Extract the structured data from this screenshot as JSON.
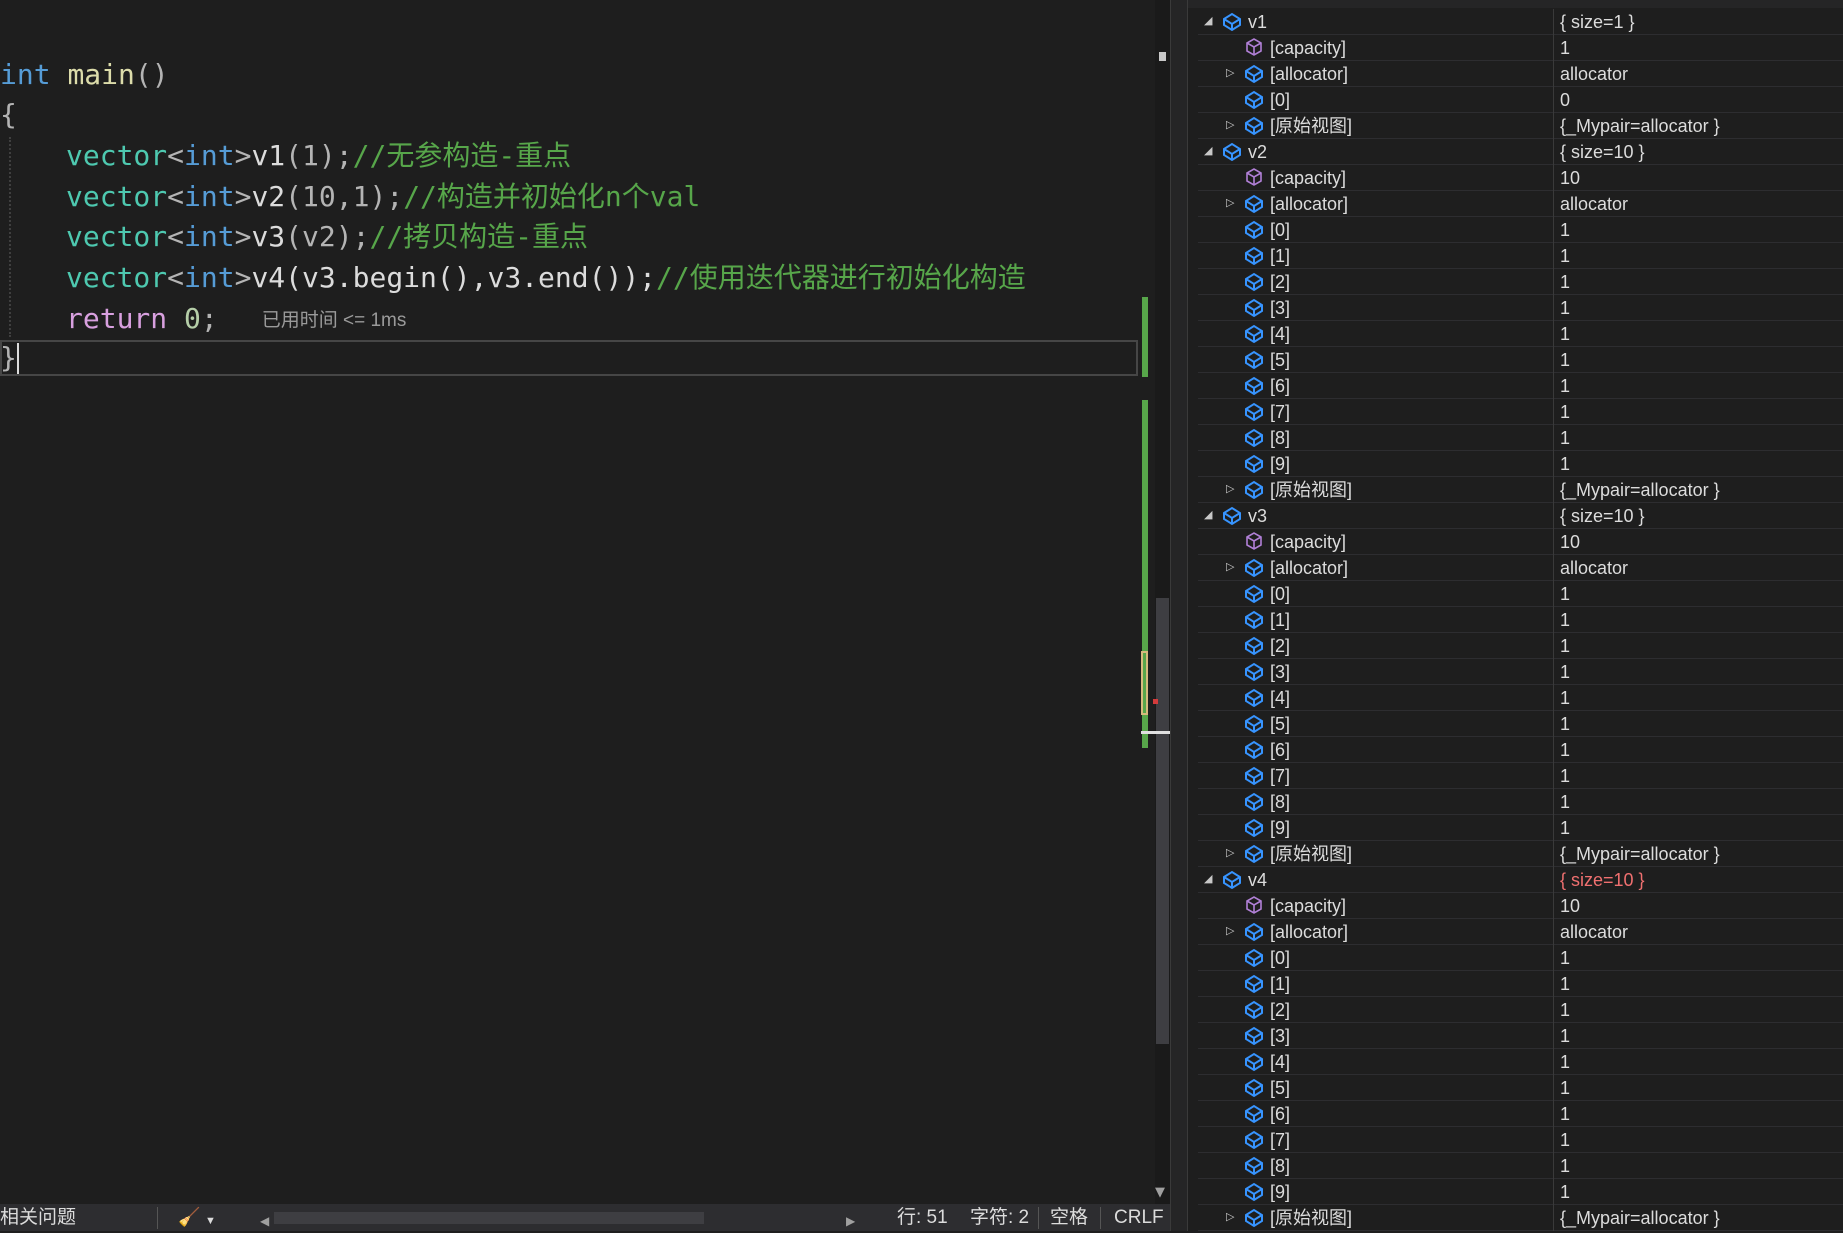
{
  "editor": {
    "lines": [
      {
        "kw": "int",
        "fn": "main",
        "rest": "()"
      },
      {
        "text": "{"
      },
      {
        "ty": "vector",
        "tpl_open": "<",
        "tpl_kw": "int",
        "tpl_close": ">",
        "var": "v1",
        "args": "(1);",
        "comment": "//无参构造-重点"
      },
      {
        "ty": "vector",
        "tpl_open": "<",
        "tpl_kw": "int",
        "tpl_close": ">",
        "var": "v2",
        "args": "(10,1);",
        "comment": "//构造并初始化n个val"
      },
      {
        "ty": "vector",
        "tpl_open": "<",
        "tpl_kw": "int",
        "tpl_close": ">",
        "var": "v3",
        "args": "(v2);",
        "comment": "//拷贝构造-重点"
      },
      {
        "ty": "vector",
        "tpl_open": "<",
        "tpl_kw": "int",
        "tpl_close": ">",
        "var": "v4",
        "args": "(v3.begin(),v3.end());",
        "comment": "//使用迭代器进行初始化构造"
      },
      {
        "ret": "return",
        "num": "0",
        "semi": ";",
        "perf": "已用时间 <= 1ms"
      },
      {
        "text": "}"
      }
    ]
  },
  "statusbar": {
    "issues": "相关问题",
    "line": "行: 51",
    "char": "字符: 2",
    "spaces": "空格",
    "eol": "CRLF"
  },
  "watch": {
    "rows": [
      {
        "level": 0,
        "expander": "expanded",
        "icon": "object",
        "name": "v1",
        "value": "{ size=1 }"
      },
      {
        "level": 1,
        "expander": "none",
        "icon": "field",
        "name": "[capacity]",
        "value": "1"
      },
      {
        "level": 1,
        "expander": "collapsed",
        "icon": "object",
        "name": "[allocator]",
        "value": "allocator"
      },
      {
        "level": 1,
        "expander": "none",
        "icon": "object",
        "name": "[0]",
        "value": "0"
      },
      {
        "level": 1,
        "expander": "collapsed",
        "icon": "object",
        "name": "[原始视图]",
        "value": "{_Mypair=allocator }"
      },
      {
        "level": 0,
        "expander": "expanded",
        "icon": "object",
        "name": "v2",
        "value": "{ size=10 }"
      },
      {
        "level": 1,
        "expander": "none",
        "icon": "field",
        "name": "[capacity]",
        "value": "10"
      },
      {
        "level": 1,
        "expander": "collapsed",
        "icon": "object",
        "name": "[allocator]",
        "value": "allocator"
      },
      {
        "level": 1,
        "expander": "none",
        "icon": "object",
        "name": "[0]",
        "value": "1"
      },
      {
        "level": 1,
        "expander": "none",
        "icon": "object",
        "name": "[1]",
        "value": "1"
      },
      {
        "level": 1,
        "expander": "none",
        "icon": "object",
        "name": "[2]",
        "value": "1"
      },
      {
        "level": 1,
        "expander": "none",
        "icon": "object",
        "name": "[3]",
        "value": "1"
      },
      {
        "level": 1,
        "expander": "none",
        "icon": "object",
        "name": "[4]",
        "value": "1"
      },
      {
        "level": 1,
        "expander": "none",
        "icon": "object",
        "name": "[5]",
        "value": "1"
      },
      {
        "level": 1,
        "expander": "none",
        "icon": "object",
        "name": "[6]",
        "value": "1"
      },
      {
        "level": 1,
        "expander": "none",
        "icon": "object",
        "name": "[7]",
        "value": "1"
      },
      {
        "level": 1,
        "expander": "none",
        "icon": "object",
        "name": "[8]",
        "value": "1"
      },
      {
        "level": 1,
        "expander": "none",
        "icon": "object",
        "name": "[9]",
        "value": "1"
      },
      {
        "level": 1,
        "expander": "collapsed",
        "icon": "object",
        "name": "[原始视图]",
        "value": "{_Mypair=allocator }"
      },
      {
        "level": 0,
        "expander": "expanded",
        "icon": "object",
        "name": "v3",
        "value": "{ size=10 }"
      },
      {
        "level": 1,
        "expander": "none",
        "icon": "field",
        "name": "[capacity]",
        "value": "10"
      },
      {
        "level": 1,
        "expander": "collapsed",
        "icon": "object",
        "name": "[allocator]",
        "value": "allocator"
      },
      {
        "level": 1,
        "expander": "none",
        "icon": "object",
        "name": "[0]",
        "value": "1"
      },
      {
        "level": 1,
        "expander": "none",
        "icon": "object",
        "name": "[1]",
        "value": "1"
      },
      {
        "level": 1,
        "expander": "none",
        "icon": "object",
        "name": "[2]",
        "value": "1"
      },
      {
        "level": 1,
        "expander": "none",
        "icon": "object",
        "name": "[3]",
        "value": "1"
      },
      {
        "level": 1,
        "expander": "none",
        "icon": "object",
        "name": "[4]",
        "value": "1"
      },
      {
        "level": 1,
        "expander": "none",
        "icon": "object",
        "name": "[5]",
        "value": "1"
      },
      {
        "level": 1,
        "expander": "none",
        "icon": "object",
        "name": "[6]",
        "value": "1"
      },
      {
        "level": 1,
        "expander": "none",
        "icon": "object",
        "name": "[7]",
        "value": "1"
      },
      {
        "level": 1,
        "expander": "none",
        "icon": "object",
        "name": "[8]",
        "value": "1"
      },
      {
        "level": 1,
        "expander": "none",
        "icon": "object",
        "name": "[9]",
        "value": "1"
      },
      {
        "level": 1,
        "expander": "collapsed",
        "icon": "object",
        "name": "[原始视图]",
        "value": "{_Mypair=allocator }"
      },
      {
        "level": 0,
        "expander": "expanded",
        "icon": "object",
        "name": "v4",
        "value": "{ size=10 }",
        "changed": true
      },
      {
        "level": 1,
        "expander": "none",
        "icon": "field",
        "name": "[capacity]",
        "value": "10"
      },
      {
        "level": 1,
        "expander": "collapsed",
        "icon": "object",
        "name": "[allocator]",
        "value": "allocator"
      },
      {
        "level": 1,
        "expander": "none",
        "icon": "object",
        "name": "[0]",
        "value": "1"
      },
      {
        "level": 1,
        "expander": "none",
        "icon": "object",
        "name": "[1]",
        "value": "1"
      },
      {
        "level": 1,
        "expander": "none",
        "icon": "object",
        "name": "[2]",
        "value": "1"
      },
      {
        "level": 1,
        "expander": "none",
        "icon": "object",
        "name": "[3]",
        "value": "1"
      },
      {
        "level": 1,
        "expander": "none",
        "icon": "object",
        "name": "[4]",
        "value": "1"
      },
      {
        "level": 1,
        "expander": "none",
        "icon": "object",
        "name": "[5]",
        "value": "1"
      },
      {
        "level": 1,
        "expander": "none",
        "icon": "object",
        "name": "[6]",
        "value": "1"
      },
      {
        "level": 1,
        "expander": "none",
        "icon": "object",
        "name": "[7]",
        "value": "1"
      },
      {
        "level": 1,
        "expander": "none",
        "icon": "object",
        "name": "[8]",
        "value": "1"
      },
      {
        "level": 1,
        "expander": "none",
        "icon": "object",
        "name": "[9]",
        "value": "1"
      },
      {
        "level": 1,
        "expander": "collapsed",
        "icon": "object",
        "name": "[原始视图]",
        "value": "{_Mypair=allocator }"
      }
    ]
  },
  "colors": {
    "changed_value": "#f07070",
    "keyword": "#569cd6",
    "type": "#4ec9b0",
    "comment": "#57a64a",
    "function": "#dcdcaa",
    "number": "#b5cea8"
  }
}
